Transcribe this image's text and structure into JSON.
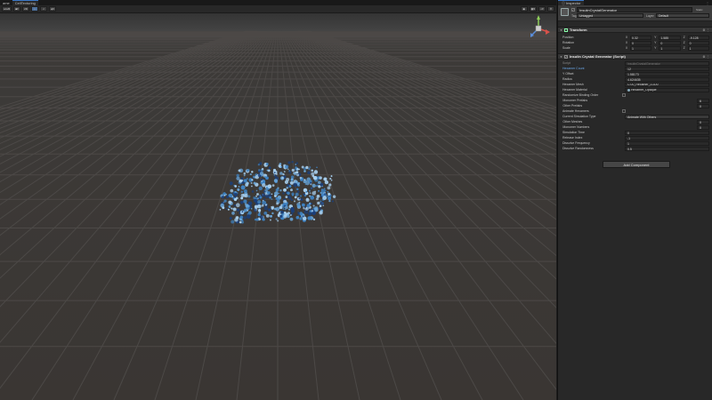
{
  "scene": {
    "tabs": [
      "ame",
      "CellTexturing"
    ],
    "toolbar": {
      "shading_mode": "ocal",
      "view_2d": "2D",
      "gizmo_label": "Persp"
    },
    "crystal": {
      "colors": {
        "light": "#a9d1f1",
        "mid": "#3f84c4",
        "dark": "#1b3f7a",
        "grid": "#4a4746",
        "ground": "#3b3836",
        "horizon": "#444444",
        "sky": "#373737"
      }
    }
  },
  "inspector": {
    "tab_title": "Inspector",
    "gameobject": {
      "name": "InsulinCrystalGenerator",
      "static_label": "Static",
      "tag_label": "Tag",
      "tag_value": "Untagged",
      "layer_label": "Layer",
      "layer_value": "Default"
    },
    "transform": {
      "title": "Transform",
      "rows": [
        {
          "label": "Position",
          "x": "0.32",
          "y": "1.585",
          "z": "-9.128"
        },
        {
          "label": "Rotation",
          "x": "0",
          "y": "0",
          "z": "0"
        },
        {
          "label": "Scale",
          "x": "1",
          "y": "1",
          "z": "1"
        }
      ]
    },
    "script_component": {
      "title": "Insulin Crystal Generator (Script)",
      "script_label": "Script",
      "script_value": "InsulinCrystalGenerator",
      "hexamer_count_label": "Hexamer Count",
      "hexamer_count_value": "12",
      "y_offset_label": "Y Offset",
      "y_offset_value": "1.58173",
      "radius_label": "Radius",
      "radius_value": "4.624635",
      "hexamer_mesh_label": "Hexamer Mesh",
      "hexamer_mesh_value": "C:00_Hexamer_LOD0",
      "hexamer_material_label": "Hexamer Material",
      "hexamer_material_value": "Hexamer_Opaque",
      "randomize_binding_order_label": "Randomize Binding Order",
      "monomer_prefabs_label": "Monomer Prefabs",
      "monomer_prefabs_count": "6",
      "other_prefabs_label": "Other Prefabs",
      "other_prefabs_count": "0",
      "animate_hexamers_label": "Animate Hexamers",
      "current_simulation_type_label": "Current Simulation Type",
      "current_simulation_type_value": "Animate With Others",
      "other_meshes_label": "Other Meshes",
      "other_meshes_count": "0",
      "monomer_numbers_label": "Monomer Numbers",
      "monomer_numbers_count": "0",
      "simulation_time_label": "Simulation Time",
      "simulation_time_value": "0",
      "release_index_label": "Release Index",
      "release_index_value": "-1",
      "dissolve_frequency_label": "Dissolve Frequency",
      "dissolve_frequency_value": "1",
      "dissolve_randomness_label": "Dissolve Randomness",
      "dissolve_randomness_value": "0.5"
    },
    "add_component_label": "Add Component"
  }
}
